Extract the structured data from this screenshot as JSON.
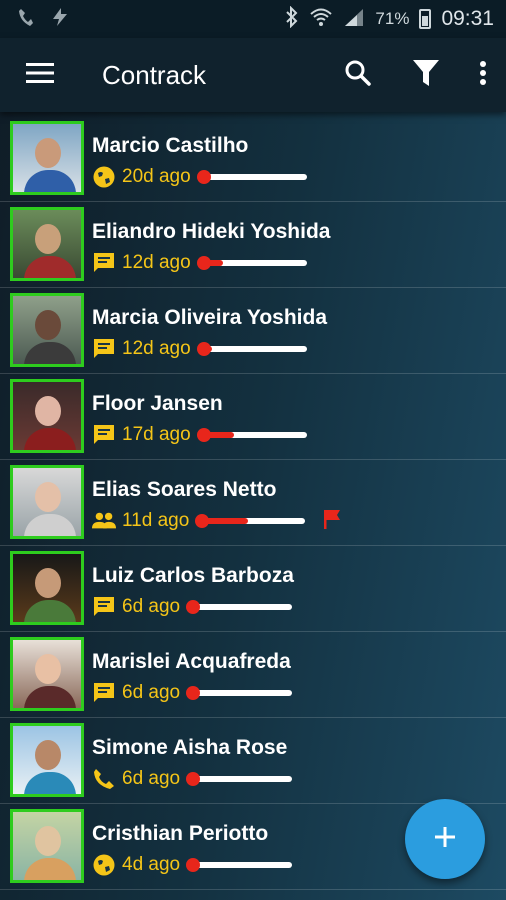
{
  "status_bar": {
    "battery": "71%",
    "time": "09:31"
  },
  "appbar": {
    "title": "Contrack",
    "icons": [
      "menu-icon",
      "search-icon",
      "filter-icon",
      "more-vert-icon"
    ]
  },
  "colors": {
    "accent_border": "#2ecc1e",
    "ago_text": "#f5c518",
    "thermometer_red": "#e8261b",
    "fab": "#2b9ddf"
  },
  "contacts": [
    {
      "name": "Marcio Castilho",
      "ago": "20d ago",
      "channel": "web-icon",
      "level": 0.04
    },
    {
      "name": "Eliandro Hideki Yoshida",
      "ago": "12d ago",
      "channel": "message-icon",
      "level": 0.18
    },
    {
      "name": "Marcia Oliveira Yoshida",
      "ago": "12d ago",
      "channel": "message-icon",
      "level": 0.08
    },
    {
      "name": "Floor Jansen",
      "ago": "17d ago",
      "channel": "message-icon",
      "level": 0.28
    },
    {
      "name": "Elias Soares Netto",
      "ago": "11d ago",
      "channel": "group-icon",
      "level": 0.43,
      "flagged": true
    },
    {
      "name": "Luiz Carlos Barboza",
      "ago": "6d ago",
      "channel": "message-icon",
      "level": 0.02
    },
    {
      "name": "Marislei Acquafreda",
      "ago": "6d ago",
      "channel": "message-icon",
      "level": 0.02
    },
    {
      "name": "Simone Aisha Rose",
      "ago": "6d ago",
      "channel": "phone-icon",
      "level": 0.02
    },
    {
      "name": "Cristhian Periotto",
      "ago": "4d ago",
      "channel": "web-icon",
      "level": 0.02
    }
  ],
  "fab": {
    "icon": "add-icon"
  }
}
